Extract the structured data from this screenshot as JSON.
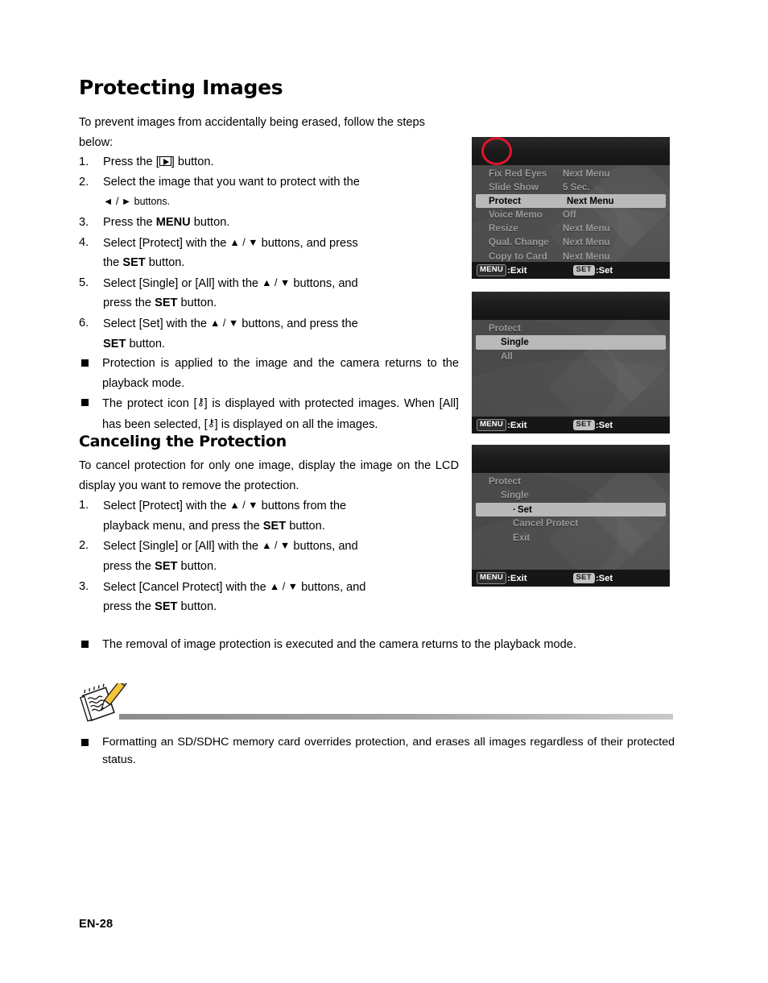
{
  "page": {
    "title": "Protecting Images",
    "subtitle": "Canceling the Protection",
    "page_number": "EN-28"
  },
  "intro": {
    "text": "To prevent images from accidentally being erased, follow the steps below:"
  },
  "steps_protect": [
    {
      "num": "1.",
      "pre": "Press the [",
      "glyph": "playback-icon",
      "post": "] button."
    },
    {
      "num": "2.",
      "line1": "Select the image that you want to protect with the",
      "line2_pre": "",
      "line2": "◄ / ► buttons."
    },
    {
      "num": "3.",
      "pre": "Press the ",
      "bold": "MENU",
      "post": " button."
    },
    {
      "num": "4.",
      "line1_a": "Select [Protect] with the ",
      "line1_arrows": "▲ / ▼",
      "line1_b": " buttons, and press",
      "line2_a": "the ",
      "line2_bold": "SET",
      "line2_b": " button."
    },
    {
      "num": "5.",
      "line1_a": "Select [Single] or [All] with the ",
      "line1_arrows": "▲ / ▼",
      "line1_b": " buttons, and",
      "line2_a": "press the ",
      "line2_bold": "SET",
      "line2_b": " button."
    },
    {
      "num": "6.",
      "line1_a": "Select [Set] with the ",
      "line1_arrows": "▲ / ▼",
      "line1_b": " buttons, and press the",
      "line2_bold": "SET",
      "line2_b": " button."
    }
  ],
  "bullets_protect": [
    {
      "text": "Protection is applied to the image and the camera returns to the playback mode."
    },
    {
      "pre": "The protect icon [",
      "glyph": "key-icon",
      "mid": "] is displayed with protected images. When [All] has been selected, [",
      "glyph2": "key-icon",
      "post": "] is displayed on all the images."
    }
  ],
  "cancel": {
    "intro": "To cancel protection for only one image, display the image on the LCD display you want to remove the protection.",
    "steps": [
      {
        "num": "1.",
        "line1_a": "Select [Protect] with the ",
        "line1_arrows": "▲ / ▼",
        "line1_b": " buttons from the",
        "line2_a": "playback menu, and press the ",
        "line2_bold": "SET",
        "line2_b": " button."
      },
      {
        "num": "2.",
        "line1_a": "Select [Single] or [All] with the ",
        "line1_arrows": "▲ / ▼",
        "line1_b": " buttons, and",
        "line2_a": "press the ",
        "line2_bold": "SET",
        "line2_b": " button."
      },
      {
        "num": "3.",
        "line1_a": "Select [Cancel Protect] with the ",
        "line1_arrows": "▲ / ▼",
        "line1_b": " buttons, and",
        "line2_a": "press the ",
        "line2_bold": "SET",
        "line2_b": " button."
      }
    ],
    "bullet": {
      "text": "The removal of image protection is executed and the camera returns to the playback mode."
    }
  },
  "note": {
    "icon": "notepad-pencil-icon",
    "text": "Formatting an SD/SDHC memory card overrides protection, and erases all images regardless of their protected status."
  },
  "lcd_screens": [
    {
      "id": "playback-menu",
      "tabs": [
        "playback-icon",
        "wrench-icon"
      ],
      "highlight_tab": "playback-icon",
      "rows": [
        {
          "label": "Fix Red Eyes",
          "value": "Next Menu",
          "selected": false
        },
        {
          "label": "Slide Show",
          "value": "5 Sec.",
          "selected": false
        },
        {
          "label": "Protect",
          "value": "Next Menu",
          "selected": true
        },
        {
          "label": "Voice Memo",
          "value": "Off",
          "selected": false
        },
        {
          "label": "Resize",
          "value": "Next Menu",
          "selected": false
        },
        {
          "label": "Qual. Change",
          "value": "Next Menu",
          "selected": false
        },
        {
          "label": "Copy to Card",
          "value": "Next Menu",
          "selected": false
        }
      ],
      "footer": {
        "menu_badge": "MENU",
        "menu_text": ":Exit",
        "set_badge": "SET",
        "set_text": ":Set"
      }
    },
    {
      "id": "protect-submenu",
      "tabs": [
        "playback-icon",
        "wrench-icon"
      ],
      "highlight_tab": null,
      "rows": [
        {
          "label": "Protect",
          "indent": 0,
          "selected": false
        },
        {
          "label": "Single",
          "indent": 1,
          "selected": true
        },
        {
          "label": "All",
          "indent": 1,
          "selected": false
        }
      ],
      "footer": {
        "menu_badge": "MENU",
        "menu_text": ":Exit",
        "set_badge": "SET",
        "set_text": ":Set"
      }
    },
    {
      "id": "protect-single-submenu",
      "tabs": [
        "playback-icon",
        "wrench-icon"
      ],
      "highlight_tab": null,
      "rows": [
        {
          "label": "Protect",
          "indent": 0,
          "selected": false
        },
        {
          "label": "Single",
          "indent": 1,
          "selected": false
        },
        {
          "label": "Set",
          "indent": 2,
          "selected": true,
          "dot": "·"
        },
        {
          "label": "Cancel Protect",
          "indent": 2,
          "selected": false
        },
        {
          "label": "Exit",
          "indent": 2,
          "selected": false
        }
      ],
      "footer": {
        "menu_badge": "MENU",
        "menu_text": ":Exit",
        "set_badge": "SET",
        "set_text": ":Set"
      }
    }
  ],
  "colors": {
    "highlight_ring": "#e0162b",
    "lcd_background": "#4a4a4a",
    "lcd_selected_row": "#b9b9b9",
    "lcd_text": "#9a9a9a",
    "lcd_bar": "#161616"
  }
}
